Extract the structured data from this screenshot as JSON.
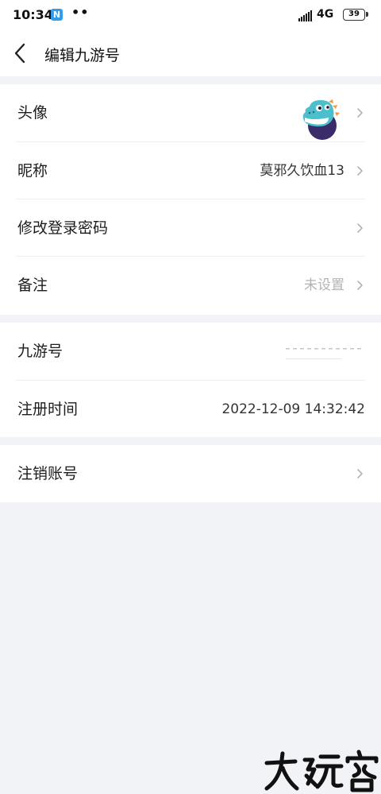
{
  "status_bar": {
    "time": "10:34",
    "app_badge": "N",
    "dots": "••",
    "network": "4G",
    "battery": "39"
  },
  "header": {
    "title": "编辑九游号"
  },
  "profile": {
    "avatar_label": "头像",
    "nickname_label": "昵称",
    "nickname_value": "莫邪久饮血13",
    "password_label": "修改登录密码",
    "remark_label": "备注",
    "remark_value": "未设置"
  },
  "account": {
    "id_label": "九游号",
    "register_label": "注册时间",
    "register_value": "2022-12-09 14:32:42"
  },
  "actions": {
    "cancel_label": "注销账号"
  },
  "colors": {
    "page_bg": "#f2f3f7",
    "card_bg": "#ffffff",
    "muted_text": "#b3b3b3",
    "avatar_teal": "#4bbfcc",
    "avatar_purple": "#3a2b6b",
    "avatar_orange": "#f39a3b"
  },
  "icons": [
    "back-arrow-icon",
    "chevron-right-icon",
    "cellular-signal-icon",
    "battery-icon",
    "app-notification-icon"
  ]
}
